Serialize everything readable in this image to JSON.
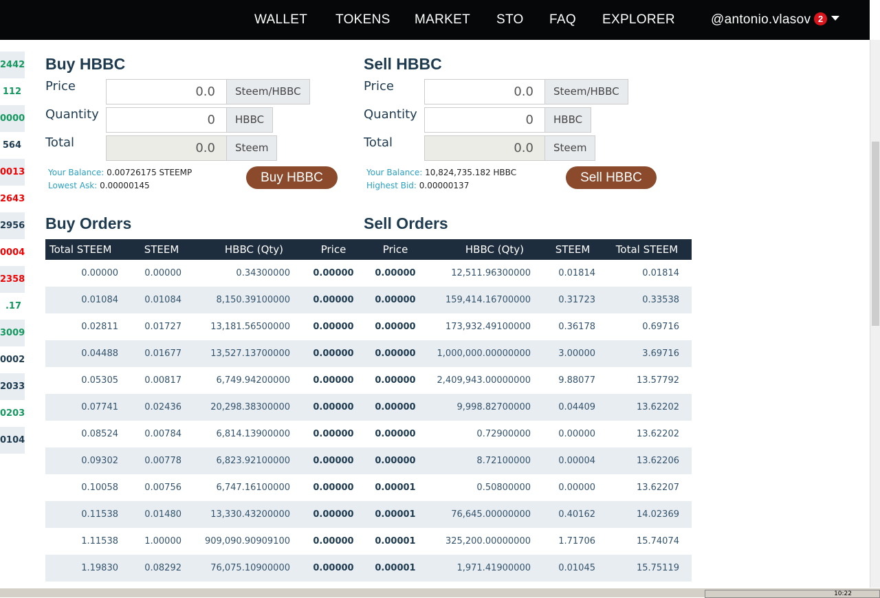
{
  "nav": {
    "items": [
      "WALLET",
      "TOKENS",
      "MARKET",
      "STO",
      "FAQ",
      "EXPLORER"
    ],
    "user": "@antonio.vlasov",
    "notifications": "2"
  },
  "ticker": [
    {
      "v": "2442",
      "c": "#14985f"
    },
    {
      "v": "112",
      "c": "#14985f"
    },
    {
      "v": "0000",
      "c": "#14985f"
    },
    {
      "v": "564",
      "c": "#1d3a4f"
    },
    {
      "v": "0013",
      "c": "#f00000"
    },
    {
      "v": "2643",
      "c": "#f00000"
    },
    {
      "v": "2956",
      "c": "#1d3a4f"
    },
    {
      "v": "0004",
      "c": "#f00000"
    },
    {
      "v": "2358",
      "c": "#f00000"
    },
    {
      "v": ".17",
      "c": "#14985f"
    },
    {
      "v": "3009",
      "c": "#14985f"
    },
    {
      "v": "0002",
      "c": "#1d3a4f"
    },
    {
      "v": "2033",
      "c": "#1d3a4f"
    },
    {
      "v": "0203",
      "c": "#14985f"
    },
    {
      "v": "0104",
      "c": "#1d3a4f"
    }
  ],
  "buy": {
    "title": "Buy HBBC",
    "price_label": "Price",
    "price": "0.0",
    "price_unit": "Steem/HBBC",
    "qty_label": "Quantity",
    "qty": "0",
    "qty_unit": "HBBC",
    "total_label": "Total",
    "total": "0.0",
    "total_unit": "Steem",
    "balance_label": "Your Balance:",
    "balance": "0.00726175 STEEMP",
    "ref_label": "Lowest Ask:",
    "ref": "0.00000145",
    "button": "Buy HBBC"
  },
  "sell": {
    "title": "Sell HBBC",
    "price_label": "Price",
    "price": "0.0",
    "price_unit": "Steem/HBBC",
    "qty_label": "Quantity",
    "qty": "0",
    "qty_unit": "HBBC",
    "total_label": "Total",
    "total": "0.0",
    "total_unit": "Steem",
    "balance_label": "Your Balance:",
    "balance": "10,824,735.182 HBBC",
    "ref_label": "Highest Bid:",
    "ref": "0.00000137",
    "button": "Sell HBBC"
  },
  "orders": {
    "buy_title": "Buy Orders",
    "sell_title": "Sell Orders",
    "headers": [
      "Total STEEM",
      "STEEM",
      "HBBC (Qty)",
      "Price",
      "Price",
      "HBBC (Qty)",
      "STEEM",
      "Total STEEM"
    ],
    "rows": [
      [
        "0.00000",
        "0.00000",
        "0.34300000",
        "0.00000",
        "0.00000",
        "12,511.96300000",
        "0.01814",
        "0.01814"
      ],
      [
        "0.01084",
        "0.01084",
        "8,150.39100000",
        "0.00000",
        "0.00000",
        "159,414.16700000",
        "0.31723",
        "0.33538"
      ],
      [
        "0.02811",
        "0.01727",
        "13,181.56500000",
        "0.00000",
        "0.00000",
        "173,932.49100000",
        "0.36178",
        "0.69716"
      ],
      [
        "0.04488",
        "0.01677",
        "13,527.13700000",
        "0.00000",
        "0.00000",
        "1,000,000.00000000",
        "3.00000",
        "3.69716"
      ],
      [
        "0.05305",
        "0.00817",
        "6,749.94200000",
        "0.00000",
        "0.00000",
        "2,409,943.00000000",
        "9.88077",
        "13.57792"
      ],
      [
        "0.07741",
        "0.02436",
        "20,298.38300000",
        "0.00000",
        "0.00000",
        "9,998.82700000",
        "0.04409",
        "13.62202"
      ],
      [
        "0.08524",
        "0.00784",
        "6,814.13900000",
        "0.00000",
        "0.00000",
        "0.72900000",
        "0.00000",
        "13.62202"
      ],
      [
        "0.09302",
        "0.00778",
        "6,823.92100000",
        "0.00000",
        "0.00000",
        "8.72100000",
        "0.00004",
        "13.62206"
      ],
      [
        "0.10058",
        "0.00756",
        "6,747.16100000",
        "0.00000",
        "0.00001",
        "0.50800000",
        "0.00000",
        "13.62207"
      ],
      [
        "0.11538",
        "0.01480",
        "13,330.43200000",
        "0.00000",
        "0.00001",
        "76,645.00000000",
        "0.40162",
        "14.02369"
      ],
      [
        "1.11538",
        "1.00000",
        "909,090.90909100",
        "0.00000",
        "0.00001",
        "325,200.00000000",
        "1.71706",
        "15.74074"
      ],
      [
        "1.19830",
        "0.08292",
        "76,075.10900000",
        "0.00000",
        "0.00001",
        "1,971.41900000",
        "0.01045",
        "15.75119"
      ]
    ]
  },
  "taskbar": {
    "clock": "10:22"
  }
}
